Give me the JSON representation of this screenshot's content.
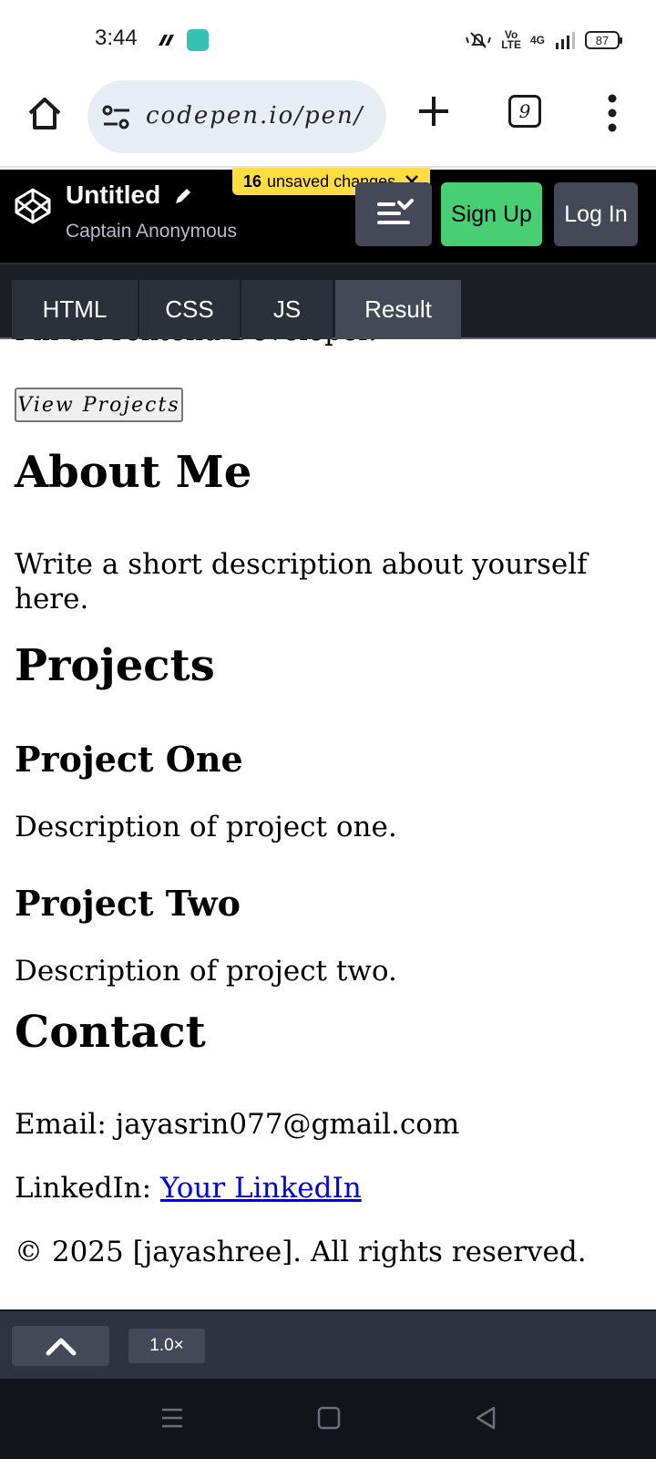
{
  "status_bar": {
    "time": "3:44",
    "battery": "87",
    "network": "4G",
    "volte": "Vo\nLTE"
  },
  "browser": {
    "url": "codepen.io/pen/",
    "tab_count": "9"
  },
  "codepen": {
    "pen_title": "Untitled",
    "author": "Captain Anonymous",
    "unsaved_count": "16",
    "unsaved_text": "unsaved changes",
    "signup_label": "Sign Up",
    "login_label": "Log In",
    "tabs": [
      {
        "label": "HTML",
        "active": false
      },
      {
        "label": "CSS",
        "active": false
      },
      {
        "label": "JS",
        "active": false
      },
      {
        "label": "Result",
        "active": true
      }
    ],
    "zoom": "1.0×"
  },
  "result": {
    "cut_text": "I'm a Frontend Developer.",
    "view_projects_button": "View Projects",
    "about_heading": "About Me",
    "about_text": "Write a short description about yourself here.",
    "projects_heading": "Projects",
    "project_one_title": "Project One",
    "project_one_desc": "Description of project one.",
    "project_two_title": "Project Two",
    "project_two_desc": "Description of project two.",
    "contact_heading": "Contact",
    "email_line": "Email: jayasrin077@gmail.com",
    "linkedin_label": "LinkedIn: ",
    "linkedin_link": "Your LinkedIn",
    "footer": "© 2025 [jayashree]. All rights reserved."
  },
  "colors": {
    "signup_bg": "#47cf73",
    "unsaved_bg": "#ffdd40",
    "header_bg": "#000000",
    "link": "#0000ee"
  }
}
